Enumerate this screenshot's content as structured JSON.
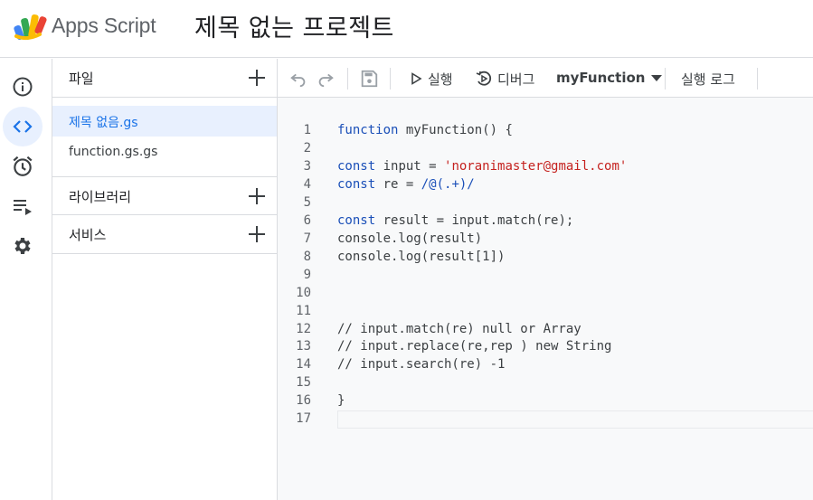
{
  "header": {
    "app_name": "Apps Script",
    "project_title": "제목 없는 프로젝트"
  },
  "rail": {
    "items": [
      {
        "name": "overview",
        "icon": "info-icon"
      },
      {
        "name": "editor",
        "icon": "code-icon",
        "active": true
      },
      {
        "name": "triggers",
        "icon": "alarm-icon"
      },
      {
        "name": "executions",
        "icon": "playlist-icon"
      },
      {
        "name": "settings",
        "icon": "gear-icon"
      }
    ]
  },
  "files_panel": {
    "files_label": "파일",
    "files": [
      {
        "name": "제목 없음.gs",
        "selected": true
      },
      {
        "name": "function.gs.gs",
        "selected": false
      }
    ],
    "libraries_label": "라이브러리",
    "services_label": "서비스"
  },
  "toolbar": {
    "run_label": "실행",
    "debug_label": "디버그",
    "function_name": "myFunction",
    "log_label": "실행 로그"
  },
  "colors": {
    "accent": "#1a73e8",
    "selected_bg": "#e8f0fe",
    "keyword": "#1a4fb8",
    "string": "#c5221f"
  },
  "code": {
    "line_numbers": [
      "1",
      "2",
      "3",
      "4",
      "5",
      "6",
      "7",
      "8",
      "9",
      "10",
      "11",
      "12",
      "13",
      "14",
      "15",
      "16",
      "17"
    ],
    "l1_kw": "function",
    "l1_rest": " myFunction() {",
    "l3_kw": "const",
    "l3_mid": " input = ",
    "l3_str": "'noranimaster@gmail.com'",
    "l4_kw": "const",
    "l4_mid": " re = ",
    "l4_rx": "/@(.+)/",
    "l6_kw": "const",
    "l6_rest": " result = input.match(re);",
    "l7": "console.log(result)",
    "l8": "console.log(result[1])",
    "l12": "// input.match(re) null or Array",
    "l13": "// input.replace(re,rep ) new String",
    "l14": "// input.search(re) -1",
    "l16": "}"
  }
}
